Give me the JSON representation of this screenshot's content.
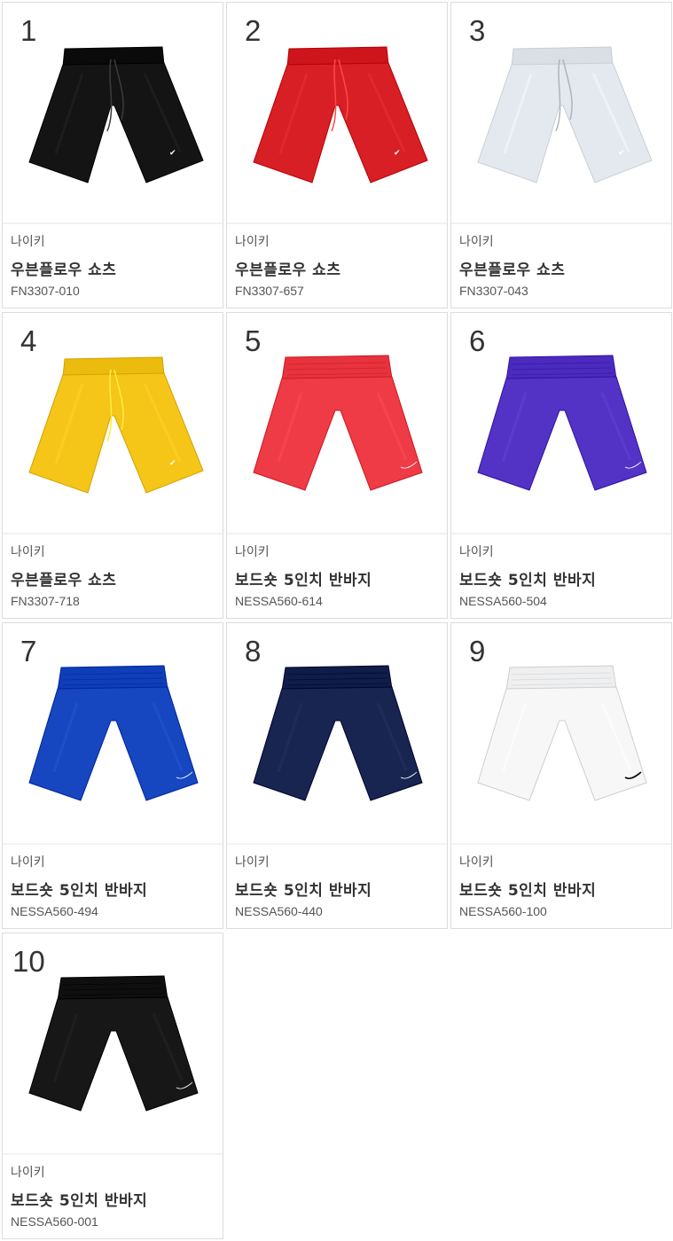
{
  "products": [
    {
      "rank": "1",
      "brand": "나이키",
      "name": "우븐플로우 쇼츠",
      "code": "FN3307-010",
      "color": "#141414",
      "accent": "#ffffff",
      "style": "woven",
      "icon": "nike-futura-logo-icon"
    },
    {
      "rank": "2",
      "brand": "나이키",
      "name": "우븐플로우 쇼츠",
      "code": "FN3307-657",
      "color": "#d81f26",
      "accent": "#ffffff",
      "style": "woven",
      "icon": "nike-futura-logo-icon"
    },
    {
      "rank": "3",
      "brand": "나이키",
      "name": "우븐플로우 쇼츠",
      "code": "FN3307-043",
      "color": "#e3e9ef",
      "accent": "#ffffff",
      "style": "woven",
      "icon": "nike-futura-logo-icon"
    },
    {
      "rank": "4",
      "brand": "나이키",
      "name": "우븐플로우 쇼츠",
      "code": "FN3307-718",
      "color": "#f5c518",
      "accent": "#ffffff",
      "style": "woven",
      "icon": "nike-futura-logo-icon"
    },
    {
      "rank": "5",
      "brand": "나이키",
      "name": "보드숏 5인치 반바지",
      "code": "NESSA560-614",
      "color": "#ee3b45",
      "accent": "#ffffff",
      "style": "board",
      "icon": "nike-swoosh-icon"
    },
    {
      "rank": "6",
      "brand": "나이키",
      "name": "보드숏 5인치 반바지",
      "code": "NESSA560-504",
      "color": "#5333c6",
      "accent": "#ffffff",
      "style": "board",
      "icon": "nike-swoosh-icon"
    },
    {
      "rank": "7",
      "brand": "나이키",
      "name": "보드숏 5인치 반바지",
      "code": "NESSA560-494",
      "color": "#1646c0",
      "accent": "#ffffff",
      "style": "board",
      "icon": "nike-swoosh-icon"
    },
    {
      "rank": "8",
      "brand": "나이키",
      "name": "보드숏 5인치 반바지",
      "code": "NESSA560-440",
      "color": "#172550",
      "accent": "#ffffff",
      "style": "board",
      "icon": "nike-swoosh-icon"
    },
    {
      "rank": "9",
      "brand": "나이키",
      "name": "보드숏 5인치 반바지",
      "code": "NESSA560-100",
      "color": "#f7f7f7",
      "accent": "#111111",
      "style": "board",
      "icon": "nike-swoosh-icon"
    },
    {
      "rank": "10",
      "brand": "나이키",
      "name": "보드숏 5인치 반바지",
      "code": "NESSA560-001",
      "color": "#171717",
      "accent": "#ffffff",
      "style": "board",
      "icon": "nike-swoosh-icon"
    }
  ]
}
